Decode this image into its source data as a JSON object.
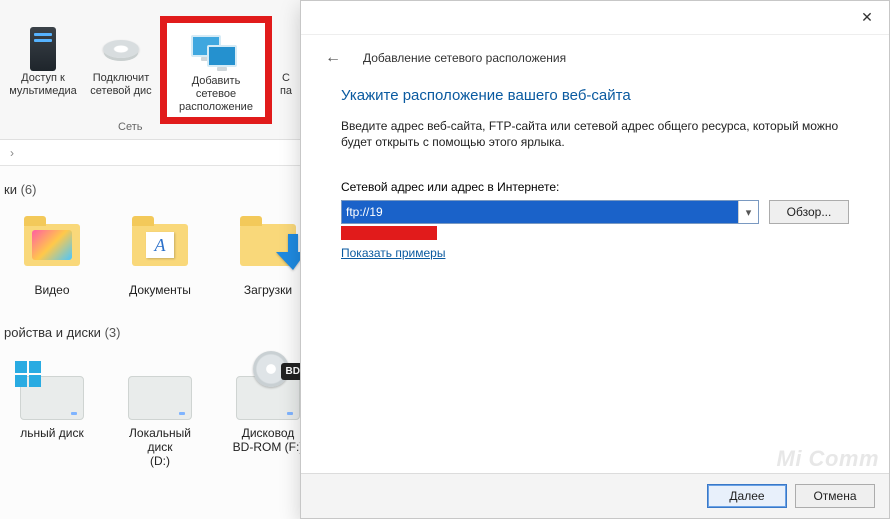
{
  "ribbon": {
    "group_label": "Сеть",
    "items": [
      {
        "line1": "Доступ к",
        "line2": "мультимедиа"
      },
      {
        "line1": "Подключит",
        "line2": "сетевой дис"
      },
      {
        "line1": "Добавить сетевое",
        "line2": "расположение"
      },
      {
        "line1": "С",
        "line2": "па"
      }
    ]
  },
  "sections": {
    "folders": {
      "title_suffix": "ки",
      "count": "(6)"
    },
    "devices": {
      "title": "ройства и диски",
      "count": "(3)"
    }
  },
  "folders": [
    {
      "label": "Видео"
    },
    {
      "label": "Документы"
    },
    {
      "label": "Загрузки"
    }
  ],
  "devices": [
    {
      "label1": "льный диск",
      "label2": ""
    },
    {
      "label1": "Локальный диск",
      "label2": "(D:)"
    },
    {
      "label1": "Дисковод",
      "label2": "BD-ROM (F:)",
      "badge": "BD"
    }
  ],
  "dialog": {
    "wizard_title": "Добавление сетевого расположения",
    "heading": "Укажите расположение вашего веб-сайта",
    "instruction": "Введите адрес веб-сайта, FTP-сайта или сетевой адрес общего ресурса, который можно будет открыть с помощью этого ярлыка.",
    "address_label": "Сетевой адрес или адрес в Интернете:",
    "address_value": "ftp://19",
    "browse": "Обзор...",
    "examples_link": "Показать примеры",
    "next": "Далее",
    "cancel": "Отмена"
  },
  "watermark": "Mi Comm"
}
